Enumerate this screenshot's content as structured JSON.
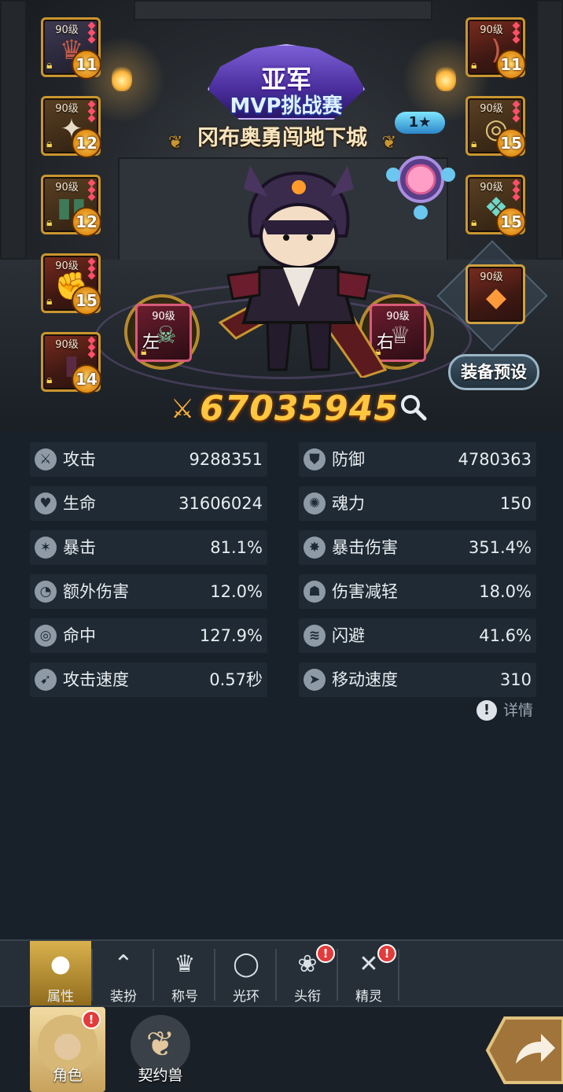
{
  "banner": {
    "logo_line1": "亚军",
    "logo_line2": "MVP挑战赛",
    "subtitle": "冈布奥勇闯地下城"
  },
  "spirit": {
    "star_text": "1★"
  },
  "gear_left": [
    {
      "level": "90级",
      "enhance": "11",
      "icon": "helmet-icon"
    },
    {
      "level": "90级",
      "enhance": "12",
      "icon": "shoulder-armor-icon"
    },
    {
      "level": "90级",
      "enhance": "12",
      "icon": "boots-icon"
    },
    {
      "level": "90级",
      "enhance": "15",
      "icon": "gauntlet-icon"
    },
    {
      "level": "90级",
      "enhance": "14",
      "icon": "legguard-icon"
    }
  ],
  "gear_right": [
    {
      "level": "90级",
      "enhance": "11",
      "icon": "bow-icon"
    },
    {
      "level": "90级",
      "enhance": "15",
      "icon": "necklace-icon"
    },
    {
      "level": "90级",
      "enhance": "15",
      "icon": "amulet-icon"
    },
    {
      "level": "90级",
      "icon": "claw-gem-icon"
    }
  ],
  "left_hand": {
    "level": "90级",
    "tag": "左"
  },
  "right_hand": {
    "level": "90级",
    "tag": "右"
  },
  "preset_button": "装备预设",
  "combat_power": "67035945",
  "stats": [
    {
      "label": "攻击",
      "value": "9288351",
      "icon": "sword-icon"
    },
    {
      "label": "防御",
      "value": "4780363",
      "icon": "shield-icon"
    },
    {
      "label": "生命",
      "value": "31606024",
      "icon": "heart-icon"
    },
    {
      "label": "魂力",
      "value": "150",
      "icon": "soul-icon"
    },
    {
      "label": "暴击",
      "value": "81.1%",
      "icon": "crit-icon"
    },
    {
      "label": "暴击伤害",
      "value": "351.4%",
      "icon": "crit-damage-icon"
    },
    {
      "label": "额外伤害",
      "value": "12.0%",
      "icon": "extra-damage-icon"
    },
    {
      "label": "伤害减轻",
      "value": "18.0%",
      "icon": "damage-reduction-icon"
    },
    {
      "label": "命中",
      "value": "127.9%",
      "icon": "target-icon"
    },
    {
      "label": "闪避",
      "value": "41.6%",
      "icon": "dodge-icon"
    },
    {
      "label": "攻击速度",
      "value": "0.57秒",
      "icon": "attack-speed-icon"
    },
    {
      "label": "移动速度",
      "value": "310",
      "icon": "move-speed-icon"
    }
  ],
  "detail_link": "详情",
  "tabs": [
    {
      "label": "属性",
      "icon": "person-icon",
      "active": true
    },
    {
      "label": "装扮",
      "icon": "hanger-icon"
    },
    {
      "label": "称号",
      "icon": "crown-icon"
    },
    {
      "label": "光环",
      "icon": "halo-icon"
    },
    {
      "label": "头衔",
      "icon": "wreath-icon",
      "badge": "!"
    },
    {
      "label": "精灵",
      "icon": "fairy-icon",
      "badge": "!"
    }
  ],
  "bottom_nav": [
    {
      "label": "角色",
      "icon": "character-icon",
      "active": true,
      "badge": "!"
    },
    {
      "label": "契约兽",
      "icon": "paw-icon"
    }
  ],
  "colors": {
    "accent_gold": "#ffc640",
    "panel": "#1f2a34",
    "badge_red": "#e33b3b"
  }
}
